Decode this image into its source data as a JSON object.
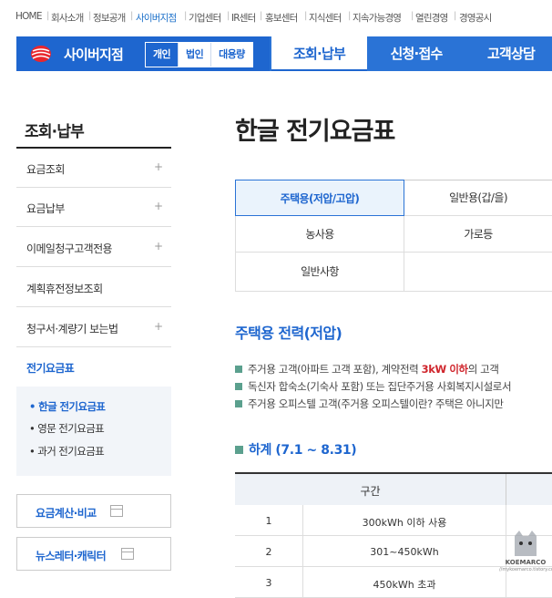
{
  "top_links": [
    "HOME",
    "회사소개",
    "정보공개",
    "사이버지점",
    "기업센터",
    "IR센터",
    "홍보센터",
    "지식센터",
    "지속가능경영",
    "열린경영",
    "경영공시"
  ],
  "brand": {
    "title": "사이버지점"
  },
  "segments": [
    "개인",
    "법인",
    "대용량"
  ],
  "main_tabs": [
    "조회·납부",
    "신청·접수",
    "고객상담"
  ],
  "sidebar": {
    "title": "조회·납부",
    "items": [
      {
        "label": "요금조회",
        "plus": "+"
      },
      {
        "label": "요금납부",
        "plus": "+"
      },
      {
        "label": "이메일청구고객전용",
        "plus": "+"
      },
      {
        "label": "계획휴전정보조회",
        "plus": ""
      },
      {
        "label": "청구서·계량기 보는법",
        "plus": "+"
      },
      {
        "label": "전기요금표",
        "plus": ""
      }
    ],
    "sub_items": [
      "• 한글 전기요금표",
      "• 영문 전기요금표",
      "• 과거 전기요금표"
    ],
    "buttons": [
      "요금계산·비교",
      "뉴스레터·캐릭터"
    ]
  },
  "page_title": "한글 전기요금표",
  "content_tabs": [
    "주택용(저압/고압)",
    "일반용(갑/을)",
    "농사용",
    "가로등",
    "일반사항"
  ],
  "section_title": "주택용 전력(저압)",
  "bullets": [
    {
      "pre": "주거용 고객(아파트 고객 포함), 계약전력 ",
      "hl": "3kW 이하",
      "post": "의 고객"
    },
    {
      "pre": "독신자 합숙소(기숙사 포함) 또는 집단주거용 사회복지시설로서",
      "hl": "",
      "post": ""
    },
    {
      "pre": "주거용 오피스텔 고객(주거용 오피스텔이란? 주택은 아니지만",
      "hl": "",
      "post": ""
    }
  ],
  "season_title": "하계 (7.1 ~ 8.31)",
  "table": {
    "header": "구간",
    "rows": [
      {
        "num": "1",
        "range": "300kWh 이하 사용"
      },
      {
        "num": "2",
        "range": "301~450kWh"
      },
      {
        "num": "3",
        "range": "450kWh 초과"
      }
    ]
  },
  "watermark": {
    "name": "KOEMARCO",
    "sub": "//mykoemarco.tistory.com"
  },
  "colors": {
    "brand": "#1e66cf",
    "bar": "#2a73d6",
    "highlight": "#d0262d",
    "bullet": "#5ba08e"
  }
}
